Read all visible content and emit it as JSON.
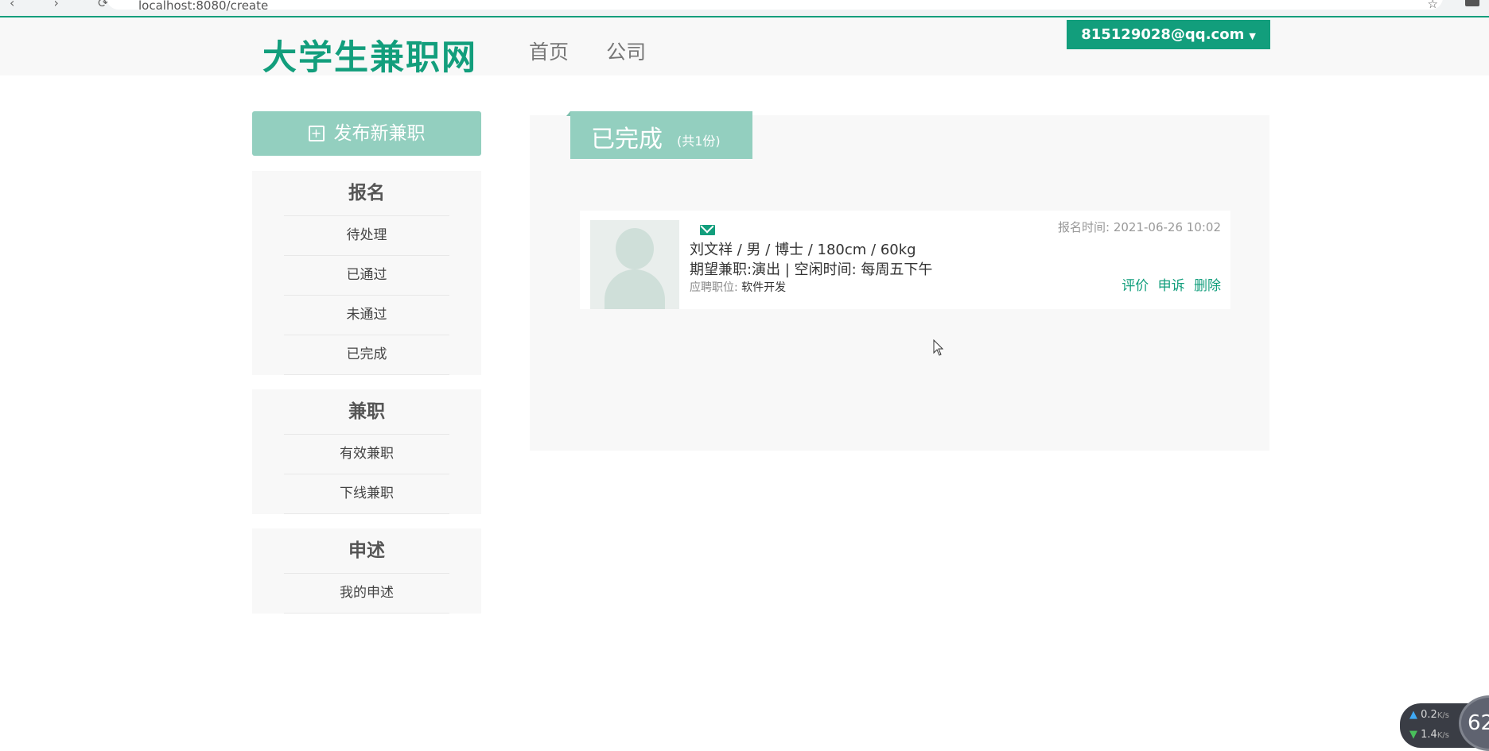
{
  "browser": {
    "url": "localhost:8080/create"
  },
  "header": {
    "logo": "大学生兼职网",
    "nav": [
      "首页",
      "公司"
    ],
    "user_email": "815129028@qq.com"
  },
  "sidebar": {
    "publish_label": "发布新兼职",
    "sections": [
      {
        "title": "报名",
        "items": [
          "待处理",
          "已通过",
          "未通过",
          "已完成"
        ]
      },
      {
        "title": "兼职",
        "items": [
          "有效兼职",
          "下线兼职"
        ]
      },
      {
        "title": "申述",
        "items": [
          "我的申述"
        ]
      }
    ]
  },
  "main": {
    "tab_title": "已完成",
    "tab_count": "(共1份)",
    "applicants": [
      {
        "info": "刘文祥 / 男 / 博士 / 180cm / 60kg",
        "expect": "期望兼职:演出 | 空闲时间: 每周五下午",
        "position_label": "应聘职位:",
        "position_value": "软件开发",
        "time": "报名时间: 2021-06-26 10:02",
        "actions": [
          "评价",
          "申诉",
          "删除"
        ]
      }
    ]
  },
  "netwidget": {
    "up": "0.2",
    "down": "1.4",
    "unit": "K/s",
    "ball": "62"
  },
  "colors": {
    "brand": "#129e7c",
    "brand_light": "#93cfbf"
  }
}
